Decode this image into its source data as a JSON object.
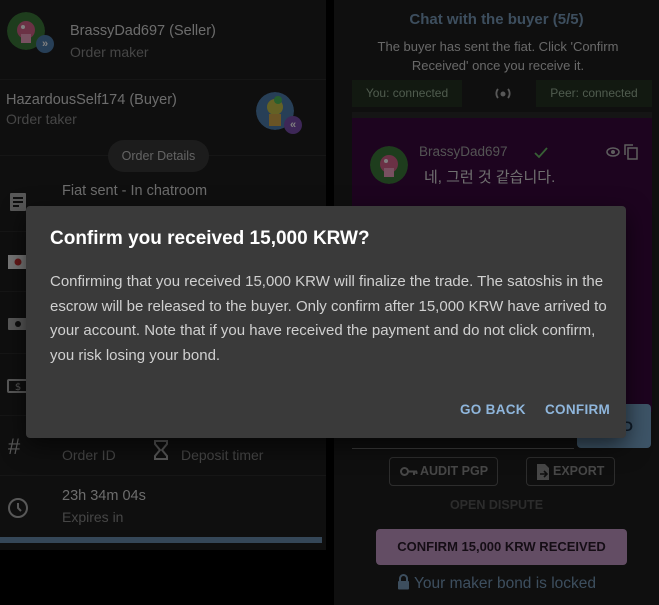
{
  "seller": {
    "name": "BrassyDad697 (Seller)",
    "role": "Order maker"
  },
  "buyer": {
    "name": "HazardousSelf174 (Buyer)",
    "role": "Order taker"
  },
  "order_details_chip": "Order Details",
  "details": [
    {
      "icon": "document-icon",
      "title": "Fiat sent - In chatroom",
      "subtitle": ""
    },
    {
      "icon": "flag-icon",
      "title": "",
      "subtitle": ""
    },
    {
      "icon": "cash-icon",
      "title": "",
      "subtitle": ""
    },
    {
      "icon": "currency-icon",
      "title": "",
      "subtitle": ""
    }
  ],
  "order_id": {
    "value": "",
    "label": "Order ID"
  },
  "deposit_timer": {
    "value": "",
    "label": "Deposit timer"
  },
  "expires": {
    "value": "23h 34m 04s",
    "label": "Expires in"
  },
  "chat": {
    "title": "Chat with the buyer (5/5)",
    "description": "The buyer has sent the fiat. Click 'Confirm Received' once you receive it.",
    "you_status": "You: connected",
    "peer_status": "Peer: connected",
    "message_author": "BrassyDad697",
    "message_text": "네, 그런 것 같습니다.",
    "send_label": "D",
    "audit_label": "AUDIT PGP",
    "export_label": "EXPORT",
    "dispute_label": "OPEN DISPUTE",
    "confirm_label": "CONFIRM 15,000 KRW RECEIVED",
    "bond_text": "Your maker bond is locked"
  },
  "dialog": {
    "title": "Confirm you received 15,000 KRW?",
    "body": "Confirming that you received 15,000 KRW will finalize the trade. The satoshis in the escrow will be released to the buyer. Only confirm after 15,000 KRW have arrived to your account. Note that if you have received the payment and do not click confirm, you risk losing your bond.",
    "go_back": "GO BACK",
    "confirm": "CONFIRM"
  },
  "colors": {
    "accent": "#7a9dbd",
    "chat_bg": "#3a083e",
    "confirm_bg": "#c69ac8",
    "dialog_bg": "#3a3a3a"
  }
}
